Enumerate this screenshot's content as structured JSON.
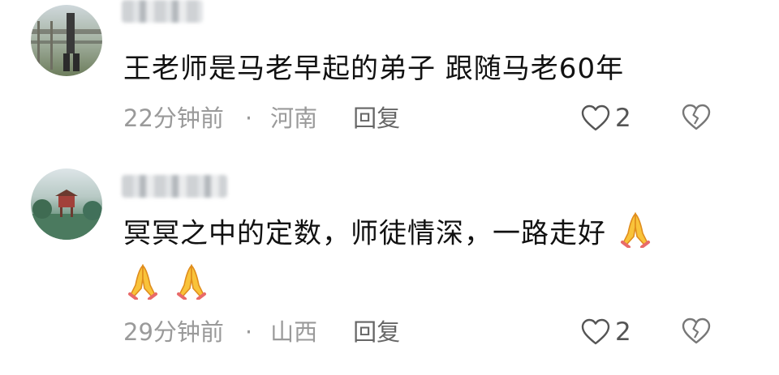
{
  "comments": [
    {
      "text": "王老师是马老早起的弟子 跟随马老60年",
      "time": "22分钟前",
      "separator": "·",
      "location": "河南",
      "reply_label": "回复",
      "like_count": "2"
    },
    {
      "text": "冥冥之中的定数，师徒情深，一路走好",
      "time": "29分钟前",
      "separator": "·",
      "location": "山西",
      "reply_label": "回复",
      "like_count": "2",
      "emoji": "folded-hands"
    }
  ]
}
